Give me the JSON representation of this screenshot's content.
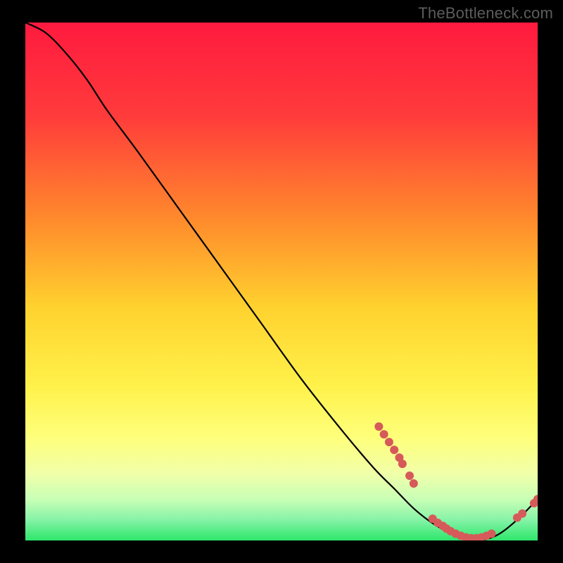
{
  "watermark": "TheBottleneck.com",
  "chart_data": {
    "type": "line",
    "title": "",
    "xlabel": "",
    "ylabel": "",
    "xlim": [
      0,
      100
    ],
    "ylim": [
      0,
      100
    ],
    "gradient_stops": [
      {
        "offset": 0.0,
        "color": "#ff1a3f"
      },
      {
        "offset": 0.18,
        "color": "#ff3b3b"
      },
      {
        "offset": 0.38,
        "color": "#ff8a2c"
      },
      {
        "offset": 0.55,
        "color": "#ffd22e"
      },
      {
        "offset": 0.7,
        "color": "#fff14a"
      },
      {
        "offset": 0.8,
        "color": "#feff7a"
      },
      {
        "offset": 0.87,
        "color": "#f1ffa8"
      },
      {
        "offset": 0.92,
        "color": "#c9ffb6"
      },
      {
        "offset": 0.96,
        "color": "#86f3a7"
      },
      {
        "offset": 1.0,
        "color": "#2de66b"
      }
    ],
    "series": [
      {
        "name": "bottleneck-curve",
        "x": [
          0,
          4,
          8,
          12,
          16,
          22,
          30,
          38,
          46,
          54,
          62,
          68,
          72,
          76,
          80,
          84,
          88,
          92,
          96,
          100
        ],
        "y": [
          100,
          98,
          94,
          89,
          83,
          75,
          64,
          53,
          42,
          31,
          21,
          14,
          10,
          6,
          3,
          1,
          0,
          1,
          4,
          8
        ]
      }
    ],
    "scatter_clusters": [
      {
        "name": "upper-cluster",
        "color": "#d65a5a",
        "radius": 6,
        "points": [
          {
            "x": 69,
            "y": 22
          },
          {
            "x": 70,
            "y": 20.5
          },
          {
            "x": 71,
            "y": 19
          },
          {
            "x": 72,
            "y": 17.5
          },
          {
            "x": 73,
            "y": 16
          },
          {
            "x": 73.6,
            "y": 14.8
          },
          {
            "x": 75,
            "y": 12.5
          },
          {
            "x": 75.8,
            "y": 11
          }
        ]
      },
      {
        "name": "valley-cluster",
        "color": "#d65a5a",
        "radius": 6,
        "points": [
          {
            "x": 79.5,
            "y": 4.2
          },
          {
            "x": 80.5,
            "y": 3.4
          },
          {
            "x": 81.5,
            "y": 2.8
          },
          {
            "x": 82.2,
            "y": 2.3
          },
          {
            "x": 83,
            "y": 1.8
          },
          {
            "x": 84,
            "y": 1.3
          },
          {
            "x": 85,
            "y": 0.9
          },
          {
            "x": 86,
            "y": 0.6
          },
          {
            "x": 87,
            "y": 0.45
          },
          {
            "x": 88,
            "y": 0.45
          },
          {
            "x": 89,
            "y": 0.6
          },
          {
            "x": 90,
            "y": 0.9
          },
          {
            "x": 91,
            "y": 1.3
          }
        ]
      },
      {
        "name": "right-tail",
        "color": "#d65a5a",
        "radius": 6,
        "points": [
          {
            "x": 96,
            "y": 4.4
          },
          {
            "x": 97,
            "y": 5.2
          },
          {
            "x": 99.3,
            "y": 7.2
          },
          {
            "x": 100,
            "y": 8.0
          }
        ]
      }
    ]
  }
}
